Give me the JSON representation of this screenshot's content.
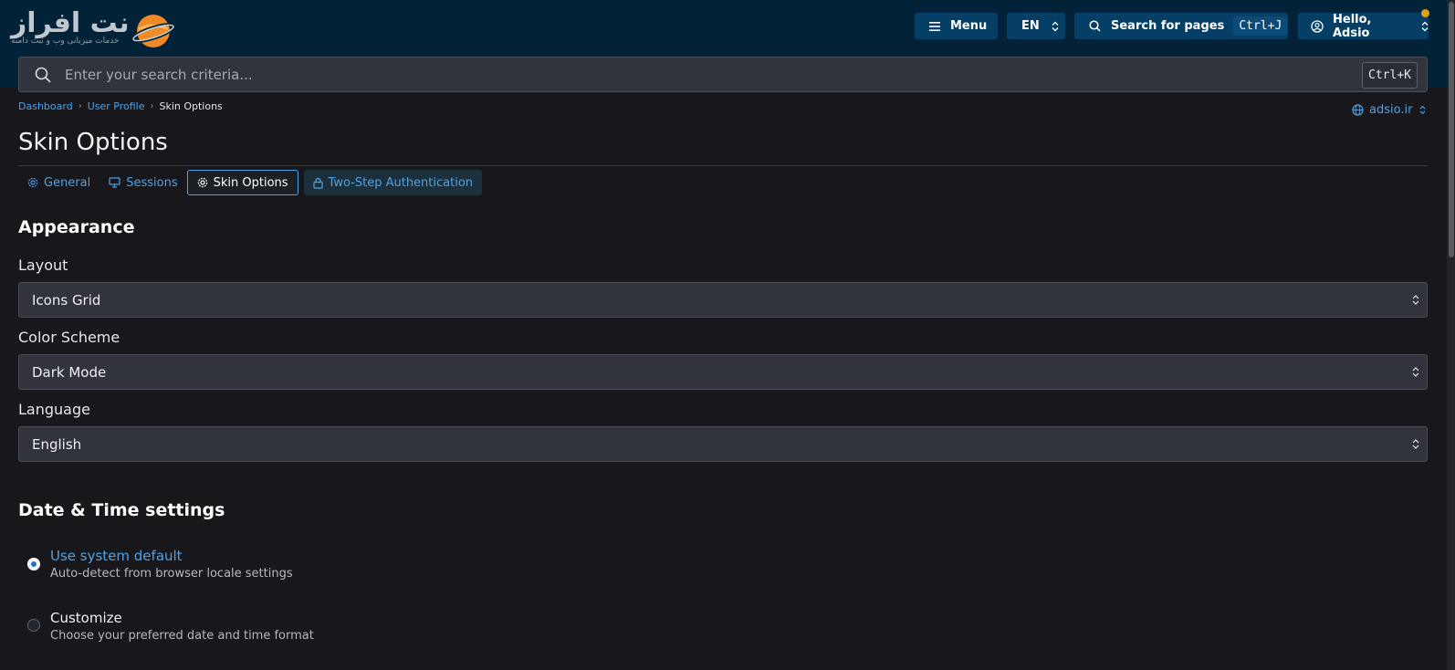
{
  "brand": {
    "logo_text": "نت افراز",
    "logo_subtitle": "خدمات میزبانی وب و ثبت دامنه"
  },
  "topbar": {
    "menu_label": "Menu",
    "language_selected": "EN",
    "page_search_label": "Search for pages",
    "page_search_shortcut": "Ctrl+J",
    "user_greeting": "Hello, Adsio"
  },
  "search": {
    "placeholder": "Enter your search criteria...",
    "shortcut": "Ctrl+K"
  },
  "breadcrumb": {
    "items": [
      "Dashboard",
      "User Profile"
    ],
    "current": "Skin Options"
  },
  "site": {
    "domain": "adsio.ir"
  },
  "page": {
    "title": "Skin Options"
  },
  "tabs": [
    {
      "label": "General",
      "icon": "gear-icon"
    },
    {
      "label": "Sessions",
      "icon": "monitor-icon"
    },
    {
      "label": "Skin Options",
      "icon": "gear-icon",
      "active": true
    },
    {
      "label": "Two-Step Authentication",
      "icon": "lock-icon"
    }
  ],
  "appearance": {
    "heading": "Appearance",
    "layout_label": "Layout",
    "layout_value": "Icons Grid",
    "color_scheme_label": "Color Scheme",
    "color_scheme_value": "Dark Mode",
    "language_label": "Language",
    "language_value": "English"
  },
  "datetime": {
    "heading": "Date & Time settings",
    "options": [
      {
        "title": "Use system default",
        "description": "Auto-detect from browser locale settings",
        "selected": true
      },
      {
        "title": "Customize",
        "description": "Choose your preferred date and time format",
        "selected": false
      }
    ]
  },
  "colors": {
    "topbar_bg": "#022238",
    "button_bg": "#063f66",
    "accent": "#4ea3e6",
    "page_bg": "#17171c",
    "notification": "#e0a013"
  }
}
